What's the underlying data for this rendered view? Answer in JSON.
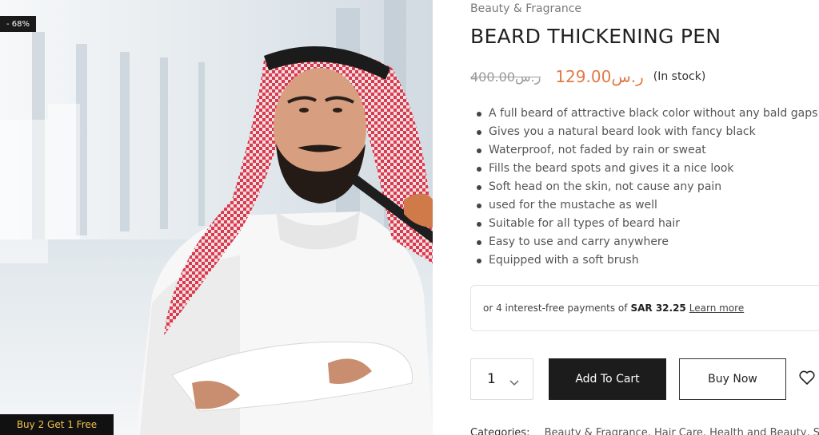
{
  "image": {
    "discount_badge": "- 68%",
    "promo_badge": "Buy 2 Get 1 Free"
  },
  "product": {
    "category": "Beauty & Fragrance",
    "title": "BEARD THICKENING PEN",
    "old_price": "400.00ر.س",
    "new_price": "129.00ر.س",
    "stock_status": "(In stock)",
    "price_color": "#e07a45",
    "features": [
      "A full beard of attractive black color without any bald gaps",
      "Gives you a natural beard look with fancy black",
      "Waterproof, not faded by rain or sweat",
      "Fills the beard spots and gives it a nice look",
      "Soft head on the skin, not cause any pain",
      "used for the mustache as well",
      "Suitable for all types of beard hair",
      "Easy to use and carry anywhere",
      "Equipped with a soft brush"
    ]
  },
  "installments": {
    "prefix": "or 4 interest-free payments of",
    "amount": "SAR 32.25",
    "learn_more": "Learn more"
  },
  "cart": {
    "quantity": "1",
    "add_to_cart": "Add To Cart",
    "buy_now": "Buy Now"
  },
  "meta": {
    "categories_label": "Categories:",
    "categories_list": "Beauty & Fragrance, Hair Care, Health and Beauty, Skin"
  },
  "icons": {
    "quantity_dropdown": "chevron-down-icon",
    "wishlist": "heart-icon"
  }
}
